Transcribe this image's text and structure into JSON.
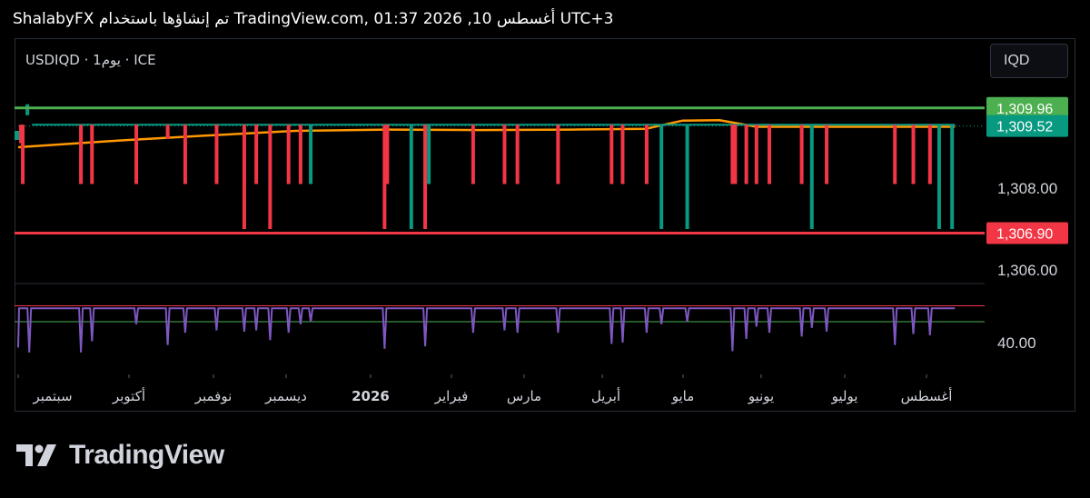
{
  "header": {
    "caption": "ShalabyFX تم إنشاؤها باستخدام TradingView.com, 01:37 2026 ,10 أغسطس UTC+3"
  },
  "symbol_line": "USDIQD · 1يوم · ICE",
  "currency_button": "IQD",
  "price_axis": {
    "ticks": [
      "1,308.00",
      "1,306.00"
    ]
  },
  "indicator_axis": {
    "ticks": [
      "40.00"
    ]
  },
  "badges": {
    "resistance": "1,309.96",
    "last_price": "1,309.52",
    "support": "1,306.90"
  },
  "time_axis": {
    "labels": [
      "سبتمبر",
      "أكتوبر",
      "نوفمبر",
      "ديسمبر",
      "2026",
      "فبراير",
      "مارس",
      "أبريل",
      "مايو",
      "يونيو",
      "يوليو",
      "أغسطس"
    ]
  },
  "brand": {
    "name": "TradingView"
  },
  "colors": {
    "bearish": "#f23645",
    "bullish": "#089981",
    "moving_average": "#ff9800",
    "rsi": "#7e57c2",
    "resistance_line": "#4caf50",
    "support_line": "#f23645",
    "last_price_badge": "#089981"
  },
  "chart_data": [
    {
      "type": "candlestick",
      "symbol": "USDIQD",
      "timeframe": "1D",
      "x_range": [
        "2025-08",
        "2026-08"
      ],
      "ylim": [
        1305.5,
        1310.3
      ],
      "horizontal_lines": [
        {
          "value": 1309.96,
          "color": "#4caf50"
        },
        {
          "value": 1306.9,
          "color": "#f23645"
        }
      ],
      "last_price": 1309.52,
      "body": [
        1309.5,
        1309.55
      ],
      "wick_drops": [
        {
          "t": 0.003,
          "low": 1309.1,
          "color": "bearish"
        },
        {
          "t": 0.005,
          "low": 1308.1,
          "color": "bearish"
        },
        {
          "t": 0.068,
          "low": 1308.1,
          "color": "bearish"
        },
        {
          "t": 0.08,
          "low": 1308.1,
          "color": "bearish"
        },
        {
          "t": 0.128,
          "low": 1308.1,
          "color": "bearish"
        },
        {
          "t": 0.162,
          "low": 1309.2,
          "color": "bearish"
        },
        {
          "t": 0.181,
          "low": 1308.1,
          "color": "bearish"
        },
        {
          "t": 0.215,
          "low": 1308.1,
          "color": "bearish"
        },
        {
          "t": 0.245,
          "low": 1307.0,
          "color": "bearish"
        },
        {
          "t": 0.258,
          "low": 1308.1,
          "color": "bearish"
        },
        {
          "t": 0.273,
          "low": 1307.0,
          "color": "bearish"
        },
        {
          "t": 0.293,
          "low": 1308.1,
          "color": "bearish"
        },
        {
          "t": 0.306,
          "low": 1308.1,
          "color": "bearish"
        },
        {
          "t": 0.317,
          "low": 1308.1,
          "color": "bullish"
        },
        {
          "t": 0.397,
          "low": 1307.0,
          "color": "bearish"
        },
        {
          "t": 0.4,
          "low": 1308.1,
          "color": "bearish"
        },
        {
          "t": 0.426,
          "low": 1307.0,
          "color": "bullish"
        },
        {
          "t": 0.441,
          "low": 1307.0,
          "color": "bearish"
        },
        {
          "t": 0.445,
          "low": 1308.1,
          "color": "bullish"
        },
        {
          "t": 0.493,
          "low": 1308.1,
          "color": "bearish"
        },
        {
          "t": 0.527,
          "low": 1308.1,
          "color": "bearish"
        },
        {
          "t": 0.541,
          "low": 1308.1,
          "color": "bearish"
        },
        {
          "t": 0.585,
          "low": 1308.1,
          "color": "bearish"
        },
        {
          "t": 0.643,
          "low": 1308.1,
          "color": "bearish"
        },
        {
          "t": 0.655,
          "low": 1308.1,
          "color": "bearish"
        },
        {
          "t": 0.681,
          "low": 1308.1,
          "color": "bearish"
        },
        {
          "t": 0.697,
          "low": 1307.0,
          "color": "bullish"
        },
        {
          "t": 0.725,
          "low": 1307.0,
          "color": "bullish"
        },
        {
          "t": 0.774,
          "low": 1308.1,
          "color": "bearish"
        },
        {
          "t": 0.777,
          "low": 1308.1,
          "color": "bearish"
        },
        {
          "t": 0.789,
          "low": 1308.1,
          "color": "bearish"
        },
        {
          "t": 0.8,
          "low": 1308.1,
          "color": "bearish"
        },
        {
          "t": 0.814,
          "low": 1308.1,
          "color": "bearish"
        },
        {
          "t": 0.849,
          "low": 1308.1,
          "color": "bearish"
        },
        {
          "t": 0.86,
          "low": 1307.0,
          "color": "bullish"
        },
        {
          "t": 0.876,
          "low": 1308.1,
          "color": "bearish"
        },
        {
          "t": 0.95,
          "low": 1308.1,
          "color": "bearish"
        },
        {
          "t": 0.97,
          "low": 1308.1,
          "color": "bearish"
        },
        {
          "t": 0.988,
          "low": 1308.1,
          "color": "bearish"
        },
        {
          "t": 0.998,
          "low": 1307.0,
          "color": "bullish"
        },
        {
          "t": 1.012,
          "low": 1307.0,
          "color": "bullish"
        }
      ],
      "moving_average": [
        {
          "t": 0.0,
          "v": 1309.0
        },
        {
          "t": 0.1,
          "v": 1309.15
        },
        {
          "t": 0.2,
          "v": 1309.28
        },
        {
          "t": 0.3,
          "v": 1309.4
        },
        {
          "t": 0.4,
          "v": 1309.43
        },
        {
          "t": 0.5,
          "v": 1309.42
        },
        {
          "t": 0.6,
          "v": 1309.43
        },
        {
          "t": 0.68,
          "v": 1309.45
        },
        {
          "t": 0.72,
          "v": 1309.65
        },
        {
          "t": 0.76,
          "v": 1309.66
        },
        {
          "t": 0.8,
          "v": 1309.5
        },
        {
          "t": 0.9,
          "v": 1309.5
        },
        {
          "t": 1.015,
          "v": 1309.5
        }
      ]
    },
    {
      "type": "line",
      "name": "RSI",
      "ylim": [
        30,
        80
      ],
      "levels": [
        70,
        57
      ],
      "baseline": 68,
      "dips": [
        {
          "t": 0.0,
          "v": 36
        },
        {
          "t": 0.003,
          "v": 68
        },
        {
          "t": 0.012,
          "v": 32
        },
        {
          "t": 0.068,
          "v": 32
        },
        {
          "t": 0.08,
          "v": 41
        },
        {
          "t": 0.128,
          "v": 55
        },
        {
          "t": 0.162,
          "v": 38
        },
        {
          "t": 0.181,
          "v": 48
        },
        {
          "t": 0.215,
          "v": 50
        },
        {
          "t": 0.245,
          "v": 49
        },
        {
          "t": 0.258,
          "v": 50
        },
        {
          "t": 0.273,
          "v": 42
        },
        {
          "t": 0.293,
          "v": 48
        },
        {
          "t": 0.306,
          "v": 55
        },
        {
          "t": 0.317,
          "v": 57
        },
        {
          "t": 0.397,
          "v": 35
        },
        {
          "t": 0.441,
          "v": 37
        },
        {
          "t": 0.493,
          "v": 48
        },
        {
          "t": 0.527,
          "v": 50
        },
        {
          "t": 0.541,
          "v": 48
        },
        {
          "t": 0.585,
          "v": 48
        },
        {
          "t": 0.643,
          "v": 39
        },
        {
          "t": 0.655,
          "v": 40
        },
        {
          "t": 0.681,
          "v": 48
        },
        {
          "t": 0.697,
          "v": 55
        },
        {
          "t": 0.725,
          "v": 57
        },
        {
          "t": 0.774,
          "v": 33
        },
        {
          "t": 0.789,
          "v": 43
        },
        {
          "t": 0.8,
          "v": 53
        },
        {
          "t": 0.814,
          "v": 48
        },
        {
          "t": 0.849,
          "v": 45
        },
        {
          "t": 0.86,
          "v": 52
        },
        {
          "t": 0.876,
          "v": 49
        },
        {
          "t": 0.95,
          "v": 38
        },
        {
          "t": 0.97,
          "v": 47
        },
        {
          "t": 0.988,
          "v": 46
        }
      ]
    }
  ]
}
